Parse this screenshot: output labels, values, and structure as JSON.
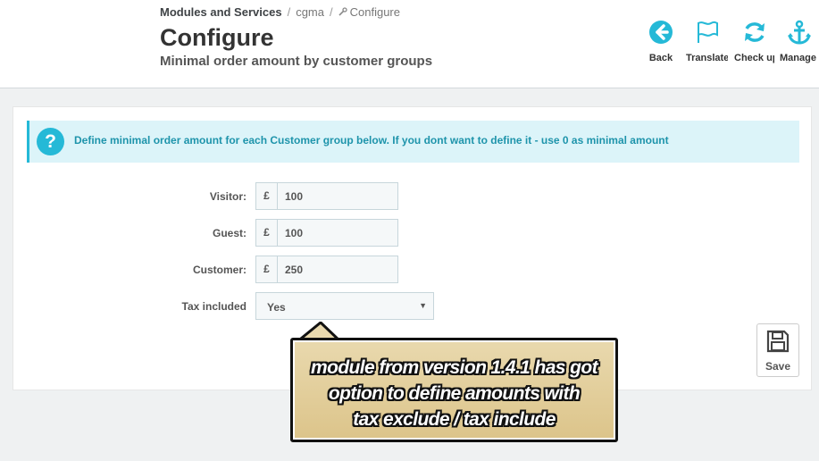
{
  "breadcrumb": {
    "root": "Modules and Services",
    "module": "cgma",
    "current": "Configure"
  },
  "header": {
    "title": "Configure",
    "subtitle": "Minimal order amount by customer groups"
  },
  "toolbar": [
    {
      "label": "Back",
      "icon": "back-arrow-icon"
    },
    {
      "label": "Translate",
      "icon": "flag-icon"
    },
    {
      "label": "Check update",
      "icon": "refresh-icon"
    },
    {
      "label": "Manage hooks",
      "icon": "anchor-icon"
    }
  ],
  "alert": {
    "icon": "question-icon",
    "text": "Define minimal order amount for each Customer group below. If you dont want to define it - use 0 as minimal amount"
  },
  "form": {
    "currency_symbol": "£",
    "visitor": {
      "label": "Visitor:",
      "value": "100"
    },
    "guest": {
      "label": "Guest:",
      "value": "100"
    },
    "customer": {
      "label": "Customer:",
      "value": "250"
    },
    "tax": {
      "label": "Tax included",
      "value": "Yes"
    }
  },
  "save": {
    "label": "Save",
    "icon": "floppy-disk-icon"
  },
  "callout": {
    "line1": "module from version 1.4.1 has got",
    "line2": "option to define amounts with",
    "line3": "tax exclude / tax include"
  },
  "colors": {
    "accent": "#25b9d7",
    "alert_bg": "#dcf4f9",
    "alert_text": "#1e94ab",
    "callout_bg": "#dcc48a"
  }
}
